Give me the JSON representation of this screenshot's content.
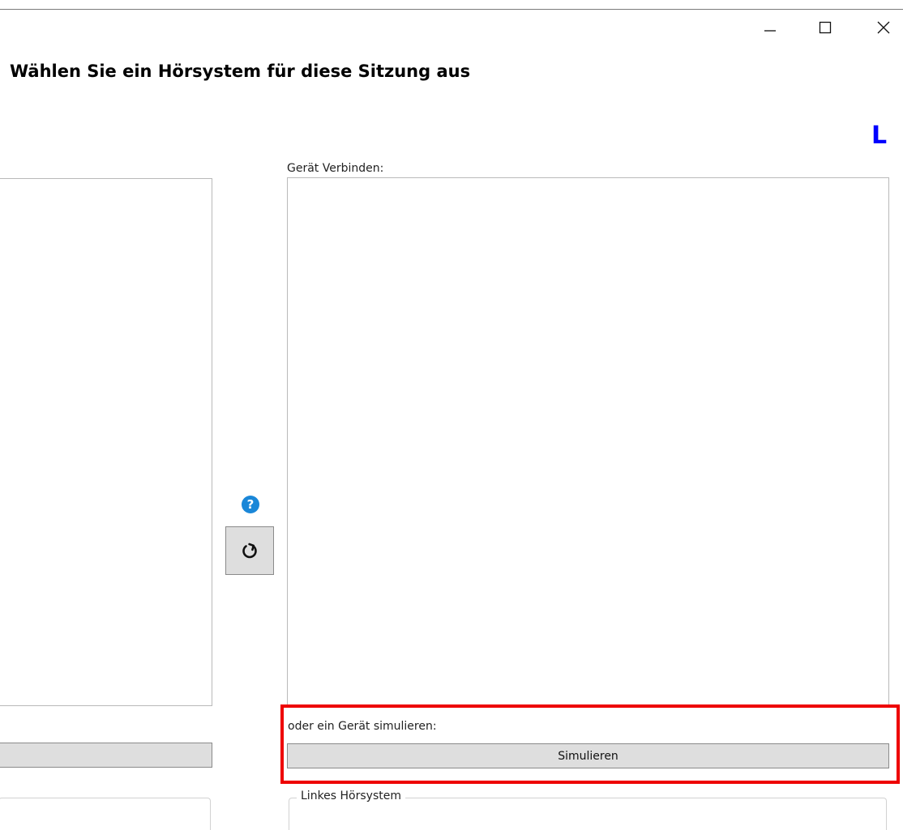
{
  "window": {
    "minimize_icon": "minimize-icon",
    "maximize_icon": "maximize-icon",
    "close_icon": "close-icon"
  },
  "dialog": {
    "title": "Wählen Sie ein Hörsystem für diese Sitzung aus",
    "side_indicator": "L"
  },
  "connect_panel": {
    "label": "Gerät Verbinden:"
  },
  "simulate_panel": {
    "label": "oder ein Gerät simulieren:",
    "button_label": "Simulieren"
  },
  "left_group": {
    "legend": "Linkes Hörsystem"
  },
  "center": {
    "help_icon": "question-circle-icon",
    "help_glyph": "?",
    "refresh_icon": "refresh-icon"
  },
  "colors": {
    "side_indicator": "#0000ff",
    "highlight": "#ee0000",
    "help_icon": "#1a87d8"
  }
}
